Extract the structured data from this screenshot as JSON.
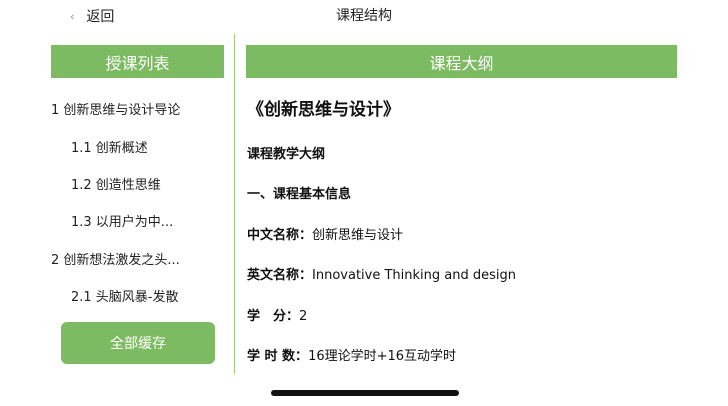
{
  "topbar": {
    "back_label": "返回",
    "title": "课程结构"
  },
  "left_panel": {
    "header": "授课列表",
    "items": [
      {
        "label": "1 创新思维与设计导论"
      },
      {
        "label": "1.1 创新概述"
      },
      {
        "label": "1.2 创造性思维"
      },
      {
        "label": "1.3 以用户为中..."
      },
      {
        "label": "2 创新想法激发之头..."
      },
      {
        "label": "2.1 头脑风暴-发散"
      }
    ],
    "cache_all_label": "全部缓存"
  },
  "right_panel": {
    "header": "课程大纲",
    "doc_title": "《创新思维与设计》",
    "section_title": "课程教学大纲",
    "subsection_title": "一、课程基本信息",
    "fields": [
      {
        "label": "中文名称：",
        "value": "创新思维与设计"
      },
      {
        "label": "英文名称：",
        "value": "Innovative Thinking and design"
      },
      {
        "label": "学　分：",
        "value": "2"
      },
      {
        "label": "学 时 数：",
        "value": "16理论学时+16互动学时"
      }
    ]
  },
  "colors": {
    "accent": "#7dbb63",
    "divider": "#9bcb7d"
  },
  "icons": {
    "back": "chevron-left-icon"
  }
}
